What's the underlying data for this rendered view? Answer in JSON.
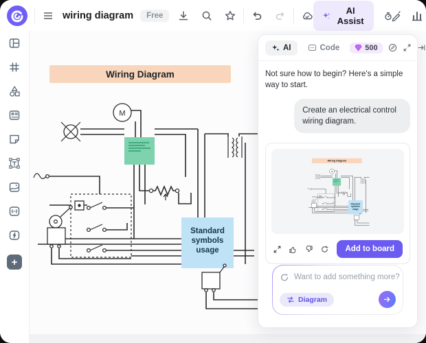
{
  "topbar": {
    "title": "wiring diagram",
    "plan_badge": "Free",
    "ai_assist_label": "AI Assist"
  },
  "sidebar": {
    "icon_names": [
      "template-icon",
      "frame-icon",
      "shapes-icon",
      "card-icon",
      "sticky-note-icon",
      "text-box-icon",
      "media-icon",
      "embed-icon",
      "apps-bolt-icon",
      "add-plus-button"
    ]
  },
  "canvas": {
    "banner_title": "Wiring Diagram",
    "motor_label": "M",
    "symbols_box": {
      "line1": "Standard",
      "line2": "symbols",
      "line3": "usage"
    }
  },
  "ai_panel": {
    "tab_ai": "AI",
    "tab_code": "Code",
    "credits": "500",
    "intro_message": "Not sure how to begin? Here's a simple way to start.",
    "user_message": "Create an electrical control wiring diagram.",
    "add_to_board_label": "Add to board",
    "input_placeholder": "Want to add something more?",
    "chip_label": "Diagram"
  },
  "colors": {
    "brand_purple": "#6F5FF6",
    "ai_button_bg": "#EFE9FD",
    "banner_peach": "#F9D6BB",
    "contactor_teal": "#7FD2AE",
    "symbols_blue": "#BFE2F7",
    "add_board_purple": "#6C5BF0",
    "credits_badge_bg": "#F4E9FD"
  }
}
